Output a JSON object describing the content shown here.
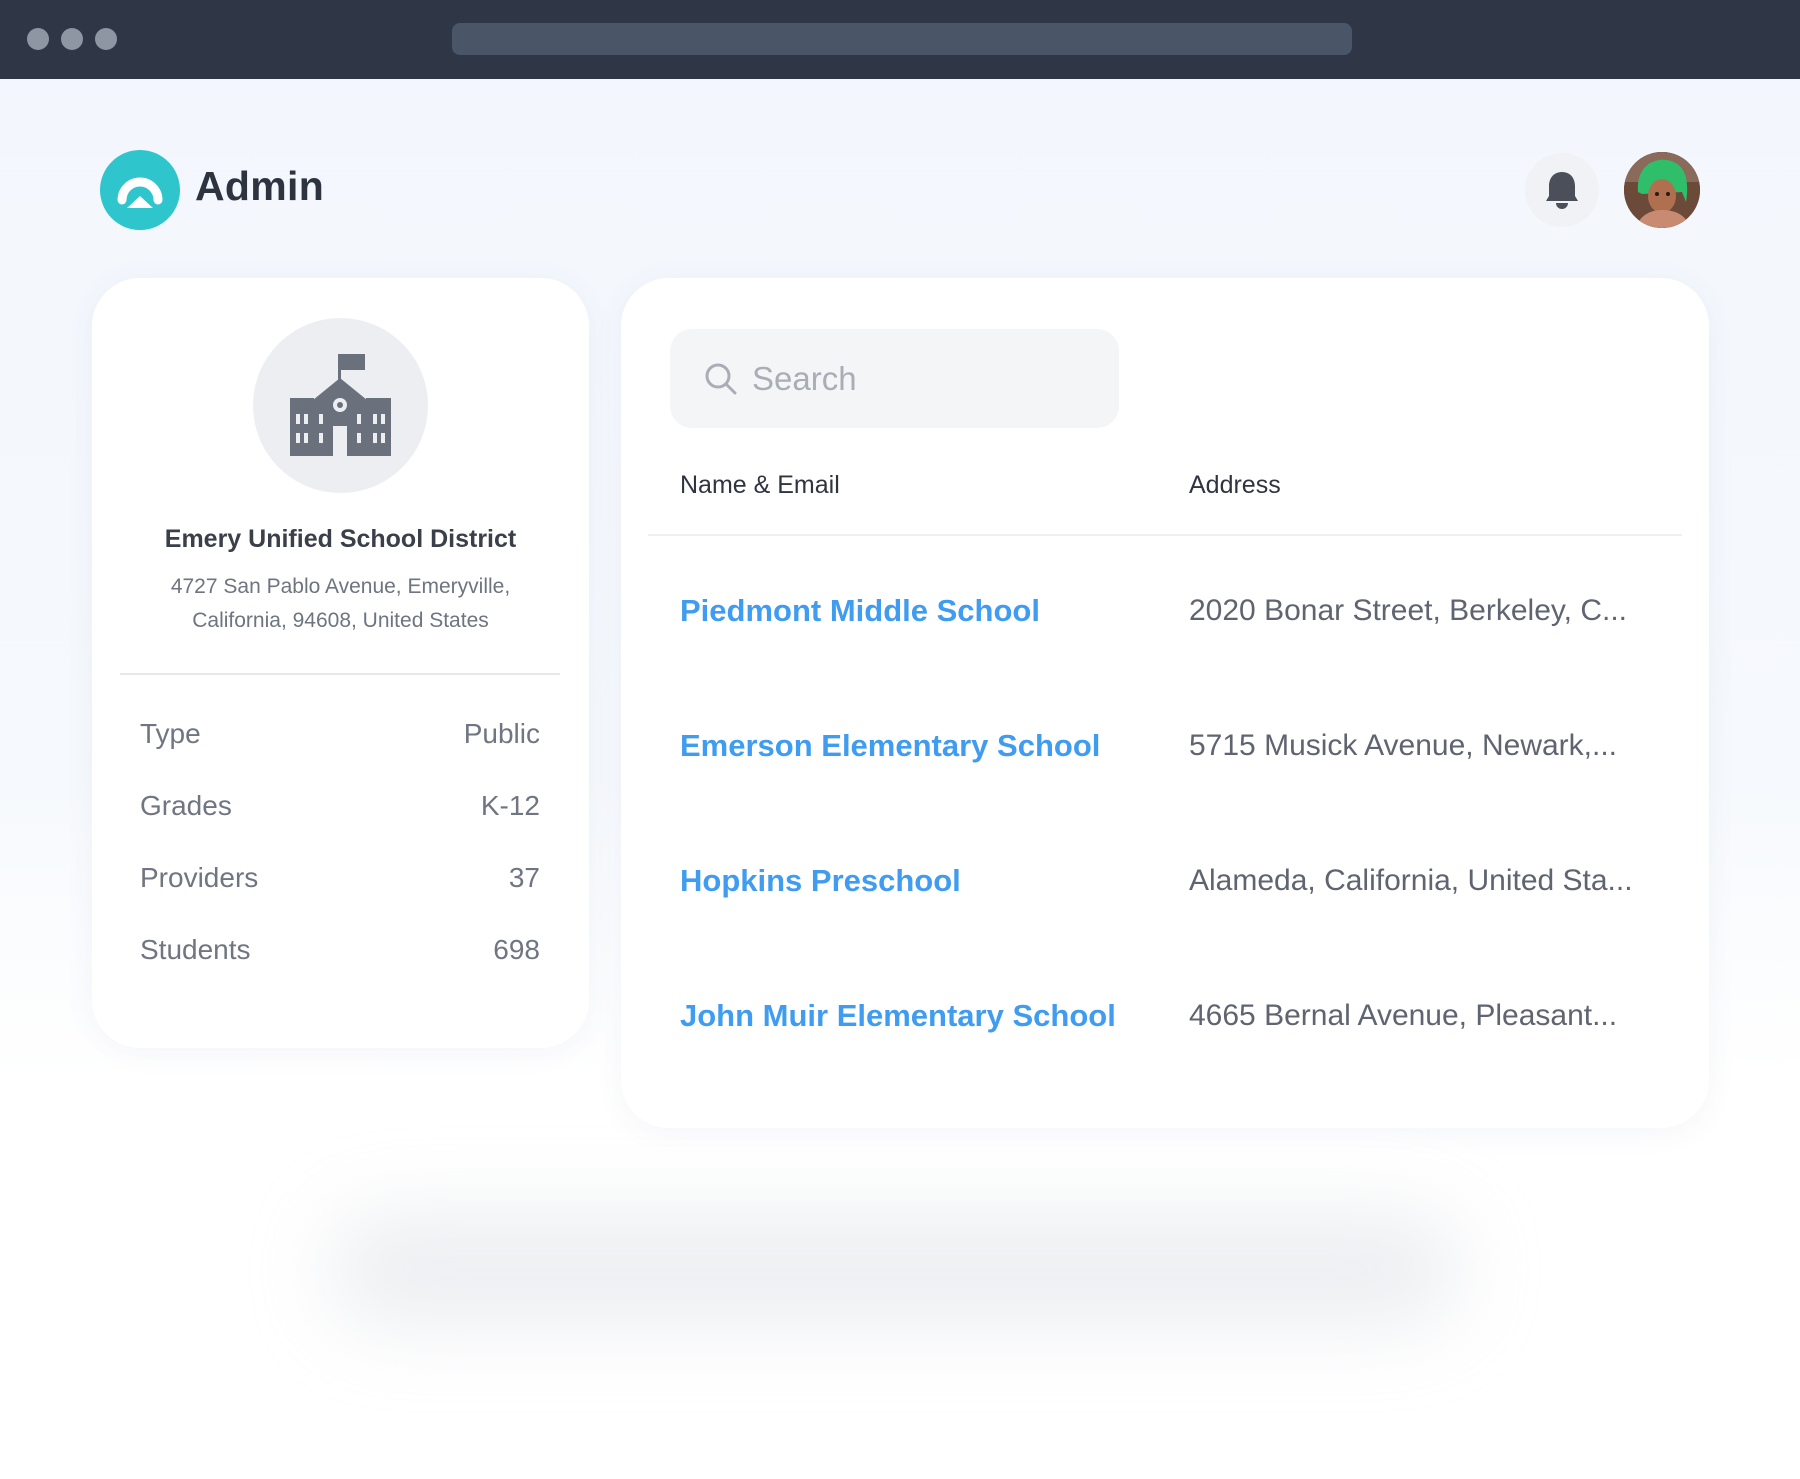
{
  "header": {
    "title": "Admin",
    "logo_icon": "arch-logo-icon",
    "notification_icon": "bell-icon",
    "avatar_icon": "user-avatar"
  },
  "district": {
    "icon": "school-building-icon",
    "name": "Emery Unified School District",
    "address_line1": "4727 San Pablo Avenue, Emeryville,",
    "address_line2": "California, 94608, United States",
    "stats": [
      {
        "label": "Type",
        "value": "Public"
      },
      {
        "label": "Grades",
        "value": "K-12"
      },
      {
        "label": "Providers",
        "value": "37"
      },
      {
        "label": "Students",
        "value": "698"
      }
    ]
  },
  "search": {
    "placeholder": "Search",
    "icon": "search-icon"
  },
  "table": {
    "columns": [
      "Name & Email",
      "Address"
    ],
    "rows": [
      {
        "name": "Piedmont Middle School",
        "address": "2020 Bonar Street, Berkeley, C..."
      },
      {
        "name": "Emerson Elementary School",
        "address": "5715 Musick Avenue,  Newark,..."
      },
      {
        "name": "Hopkins Preschool",
        "address": "Alameda, California, United Sta..."
      },
      {
        "name": "John Muir Elementary School",
        "address": "4665 Bernal Avenue, Pleasant..."
      }
    ]
  },
  "colors": {
    "accent": "#2fc5cd",
    "link": "#3f9cf0",
    "browser_chrome": "#2f3747"
  }
}
